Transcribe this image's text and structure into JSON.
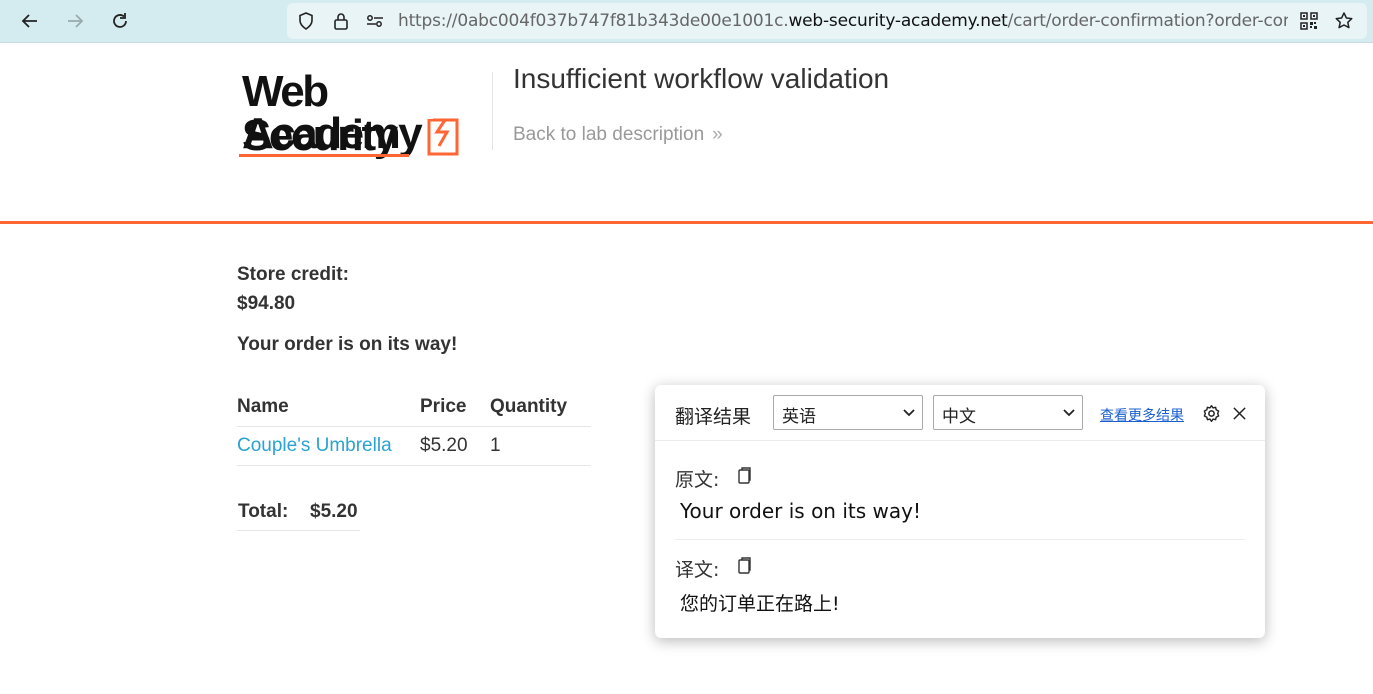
{
  "browser": {
    "url_prefix": "https://0abc004f037b747f81b343de00e1001c.",
    "url_host": "web-security-academy.net",
    "url_path": "/cart/order-confirmation?order-confirmed=true"
  },
  "header": {
    "logo_line1": "Web Security",
    "logo_line2": "Academy",
    "lab_title": "Insufficient workflow validation",
    "back_link": "Back to lab description",
    "back_chevron": "»",
    "accent_color": "#ff6633"
  },
  "content": {
    "store_credit_label": "Store credit:",
    "store_credit_value": "$94.80",
    "order_message": "Your order is on its way!",
    "table": {
      "headers": [
        "Name",
        "Price",
        "Quantity"
      ],
      "rows": [
        {
          "name": "Couple's Umbrella",
          "price": "$5.20",
          "quantity": "1"
        }
      ]
    },
    "total_label": "Total:",
    "total_value": "$5.20"
  },
  "translator": {
    "title": "翻译结果",
    "source_lang": "英语",
    "target_lang": "中文",
    "more_results": "查看更多结果",
    "source_label": "原文:",
    "source_text": "Your order is on its way!",
    "target_label": "译文:",
    "target_text": "您的订单正在路上!"
  }
}
